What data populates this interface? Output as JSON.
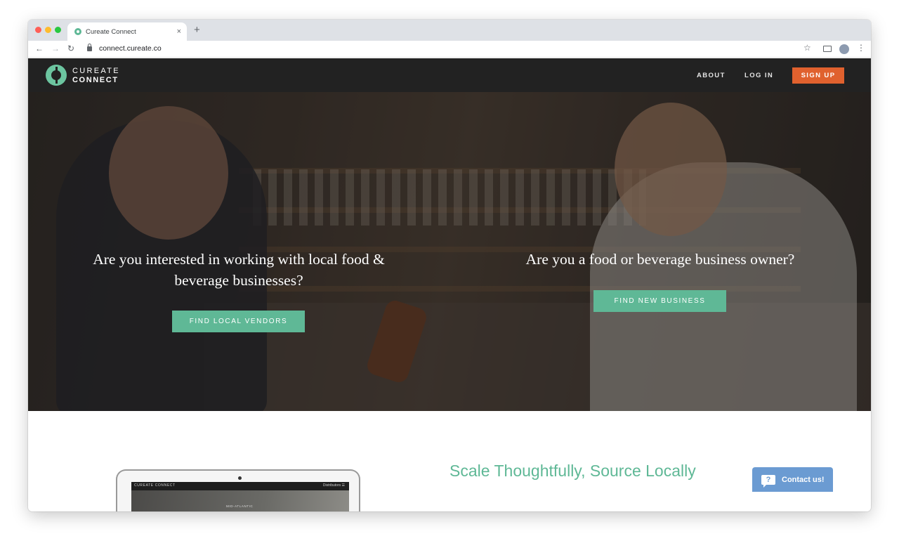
{
  "browser": {
    "tab_title": "Cureate Connect",
    "tab_close": "×",
    "new_tab": "+",
    "url": "connect.cureate.co",
    "icons": {
      "back": "arrow-left-icon",
      "forward": "arrow-right-icon",
      "reload": "reload-icon",
      "star": "star-icon",
      "menu": "kebab-menu-icon"
    },
    "glyphs": {
      "back": "←",
      "forward": "→",
      "reload": "↻",
      "star": "☆",
      "menu": "⋮"
    }
  },
  "header": {
    "logo_top": "CUREATE",
    "logo_bottom": "CONNECT",
    "nav": {
      "about": "ABOUT",
      "login": "LOG IN",
      "signup": "SIGN UP"
    },
    "colors": {
      "background": "#222222",
      "signup": "#e0612e",
      "brand_green": "#6cc5a0"
    }
  },
  "hero": {
    "left_question": "Are you interested in working with local food & beverage businesses?",
    "left_button": "FIND LOCAL VENDORS",
    "right_question": "Are you a food or beverage business owner?",
    "right_button": "FIND NEW BUSINESS",
    "button_color": "#5fb896"
  },
  "preview": {
    "screen_brand": "CUREATE CONNECT",
    "screen_nav": "Distributors ☰",
    "screen_caption": "MID-ATLANTIC"
  },
  "section": {
    "title": "Scale Thoughtfully, Source Locally",
    "title_color": "#5fb896"
  },
  "contact": {
    "label": "Contact us!",
    "icon_glyph": "?",
    "color": "#6b9bd2"
  }
}
